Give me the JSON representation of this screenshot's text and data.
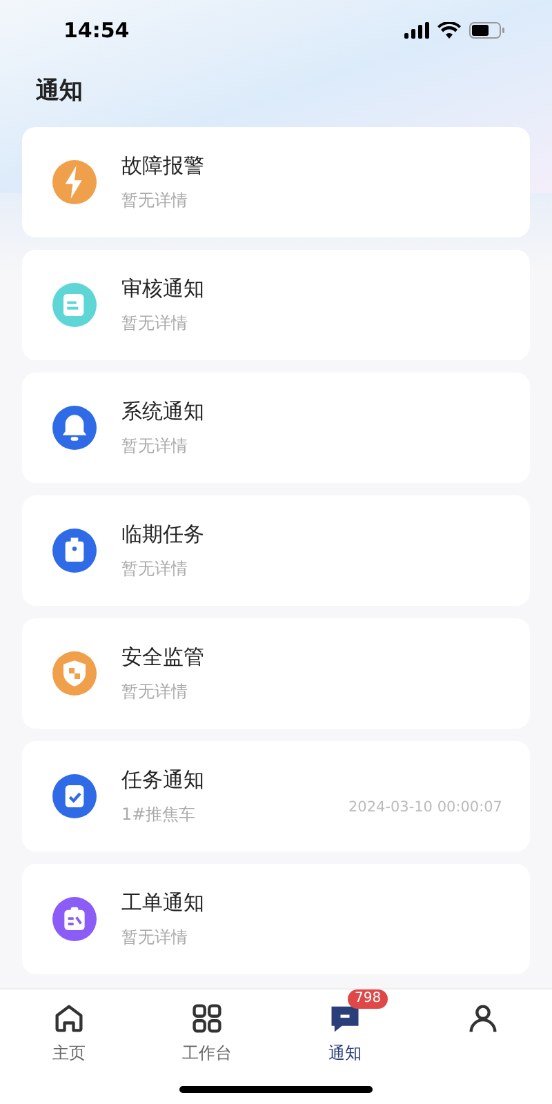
{
  "status_bar": {
    "time": "14:54"
  },
  "page_title": "通知",
  "notifications": [
    {
      "color": "#f0a04b",
      "title": "故障报警",
      "detail": "暂无详情"
    },
    {
      "color": "#5fd6d6",
      "title": "审核通知",
      "detail": "暂无详情"
    },
    {
      "color": "#2f6be6",
      "title": "系统通知",
      "detail": "暂无详情"
    },
    {
      "color": "#2f6be6",
      "title": "临期任务",
      "detail": "暂无详情"
    },
    {
      "color": "#f0a04b",
      "title": "安全监管",
      "detail": "暂无详情"
    },
    {
      "color": "#2f6be6",
      "title": "任务通知",
      "detail": "1#推焦车",
      "time": "2024-03-10 00:00:07"
    },
    {
      "color": "#8b5cf6",
      "title": "工单通知",
      "detail": "暂无详情"
    }
  ],
  "tab_bar": [
    {
      "label": "主页",
      "selected": false
    },
    {
      "label": "工作台",
      "selected": false
    },
    {
      "label": "通知",
      "selected": true,
      "badge": "798"
    },
    {
      "selected": false
    }
  ]
}
